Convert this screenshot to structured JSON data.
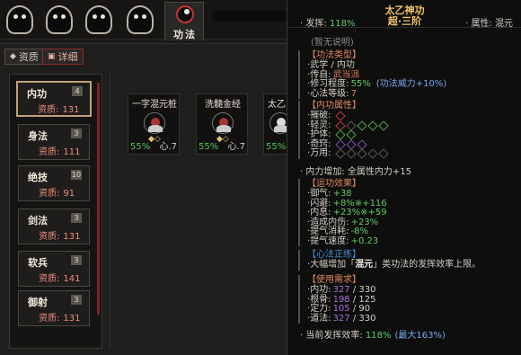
{
  "top_tab": {
    "label": "功法"
  },
  "subtabs": [
    {
      "label": "资质"
    },
    {
      "label": "详细"
    }
  ],
  "attributes": [
    {
      "name": "内功",
      "level": "4",
      "aptitude_label": "资质:",
      "aptitude": "131"
    },
    {
      "name": "身法",
      "level": "3",
      "aptitude_label": "资质:",
      "aptitude": "111"
    },
    {
      "name": "绝技",
      "level": "10",
      "aptitude_label": "资质:",
      "aptitude": "91"
    },
    {
      "name": "剑法",
      "level": "3",
      "aptitude_label": "资质:",
      "aptitude": "131"
    },
    {
      "name": "软兵",
      "level": "3",
      "aptitude_label": "资质:",
      "aptitude": "141"
    },
    {
      "name": "御射",
      "level": "3",
      "aptitude_label": "资质:",
      "aptitude": "131"
    }
  ],
  "cards": [
    {
      "title": "一字混元桩",
      "pct": "55%",
      "xin": "心.7"
    },
    {
      "title": "洗髓金经",
      "pct": "55%",
      "xin": "心.7"
    },
    {
      "title": "太乙",
      "pct": "55%",
      "xin": ""
    }
  ],
  "tooltip": {
    "name": "太乙神功",
    "tier": "超·三阶",
    "fahui_label": "发挥:",
    "fahui_value": "118%",
    "attr_label": "属性:",
    "attr_value": "混元",
    "no_desc": "(暂无说明)",
    "type_section": {
      "header": "【功法类型】",
      "rows": [
        {
          "k": "武学 / 内功",
          "v": ""
        },
        {
          "k": "传自:",
          "v": "武当派"
        },
        {
          "k": "修习程度:",
          "v": "55%",
          "extra": "(功法威力+10%)"
        },
        {
          "k": "心法等级:",
          "v": "7"
        }
      ]
    },
    "neigong_section": {
      "header": "【内功属性】",
      "rows": [
        {
          "k": "摧破:"
        },
        {
          "k": "轻灵:"
        },
        {
          "k": "护体:"
        },
        {
          "k": "奇窍:"
        },
        {
          "k": "万用:"
        }
      ]
    },
    "neili": {
      "label": "内力增加:",
      "value": "全属性内力+15"
    },
    "yungong": {
      "header": "【运功效果】",
      "rows": [
        {
          "k": "御气:",
          "v": "+38"
        },
        {
          "k": "闪避:",
          "v": "+8%※+116"
        },
        {
          "k": "内息:",
          "v": "+23%※+59"
        },
        {
          "k": "造成内伤:",
          "v": "+23%"
        },
        {
          "k": "提气消耗:",
          "v": "-8%"
        },
        {
          "k": "提气速度:",
          "v": "+0.23"
        }
      ]
    },
    "xinfa": {
      "header": "【心法正练】",
      "text_pre": "大幅增加「",
      "text_key": "混元",
      "text_post": "」类功法的发挥效率上限。"
    },
    "req": {
      "header": "【使用需求】",
      "rows": [
        {
          "k": "内功:",
          "v": "327",
          "t": "/ 330"
        },
        {
          "k": "根骨:",
          "v": "198",
          "t": "/ 125"
        },
        {
          "k": "定力:",
          "v": "105",
          "t": "/ 90"
        },
        {
          "k": "道法:",
          "v": "327",
          "t": "/ 330"
        }
      ]
    },
    "efficiency": {
      "label": "当前发挥效率:",
      "value": "118%",
      "max": "(最大163%)"
    }
  },
  "colors": {
    "accent_red": "#c33232",
    "gold": "#f1c36b",
    "green": "#5ecc63",
    "blue": "#77a8ea",
    "section": "#e08662"
  }
}
